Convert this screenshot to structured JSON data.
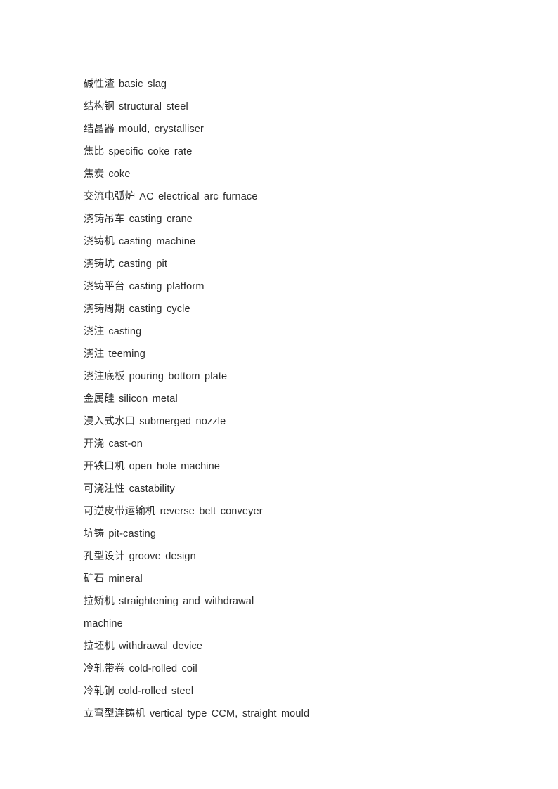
{
  "document": {
    "page_background": "#ffffff",
    "text_color": "#2b2b2b",
    "entries": [
      {
        "term": "碱性渣",
        "gloss": "basic slag"
      },
      {
        "term": "结构钢",
        "gloss": "structural steel"
      },
      {
        "term": "结晶器",
        "gloss": "mould, crystalliser"
      },
      {
        "term": "焦比",
        "gloss": "specific coke rate"
      },
      {
        "term": "焦炭",
        "gloss": "coke"
      },
      {
        "term": "交流电弧炉",
        "gloss": "AC electrical arc furnace"
      },
      {
        "term": "浇铸吊车",
        "gloss": "casting crane"
      },
      {
        "term": "浇铸机",
        "gloss": "casting machine"
      },
      {
        "term": "浇铸坑",
        "gloss": "casting pit"
      },
      {
        "term": "浇铸平台",
        "gloss": "casting platform"
      },
      {
        "term": "浇铸周期",
        "gloss": "casting cycle"
      },
      {
        "term": "浇注",
        "gloss": "casting"
      },
      {
        "term": "浇注",
        "gloss": "teeming"
      },
      {
        "term": "浇注底板",
        "gloss": "pouring bottom plate"
      },
      {
        "term": "金属硅",
        "gloss": "silicon metal"
      },
      {
        "term": "浸入式水口",
        "gloss": "submerged nozzle"
      },
      {
        "term": "开浇",
        "gloss": "cast-on"
      },
      {
        "term": "开铁口机",
        "gloss": "open hole machine"
      },
      {
        "term": "可浇注性",
        "gloss": "castability"
      },
      {
        "term": "可逆皮带运输机",
        "gloss": "reverse belt conveyer"
      },
      {
        "term": "坑铸",
        "gloss": "pit-casting"
      },
      {
        "term": "孔型设计",
        "gloss": "groove design"
      },
      {
        "term": "矿石",
        "gloss": "mineral"
      },
      {
        "term": "拉矫机",
        "gloss": "straightening and withdrawal"
      },
      {
        "term": "",
        "gloss": "machine",
        "continuation": true
      },
      {
        "term": "拉坯机",
        "gloss": "withdrawal device"
      },
      {
        "term": "冷轧带卷",
        "gloss": "cold-rolled coil"
      },
      {
        "term": "冷轧钢",
        "gloss": "cold-rolled steel"
      },
      {
        "term": "立弯型连铸机",
        "gloss": "vertical type CCM, straight mould"
      }
    ]
  }
}
